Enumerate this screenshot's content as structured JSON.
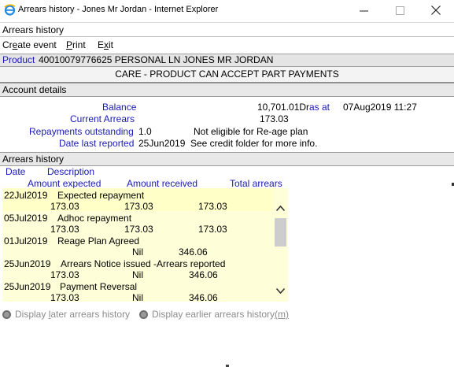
{
  "window": {
    "title": "Arrears history - Jones Mr Jordan - Internet Explorer",
    "minimize_glyph": "–",
    "maximize_glyph": "☐",
    "close_glyph": "✕"
  },
  "app_header": "Arrears history",
  "menu": [
    {
      "label": "Create event",
      "underline_index": 2
    },
    {
      "label": "Print",
      "underline_index": 0
    },
    {
      "label": "Exit",
      "underline_index": 1
    }
  ],
  "product": {
    "label": "Product",
    "value": "40010079776625 PERSONAL LN JONES MR JORDAN",
    "care": "CARE - PRODUCT CAN ACCEPT PART PAYMENTS"
  },
  "account_details": {
    "heading": "Account details",
    "balance_label": "Balance",
    "balance_value": "10,701.01Dr",
    "as_at_label": "as at",
    "as_at_value": "07Aug2019 11:27",
    "current_arrears_label": "Current Arrears",
    "current_arrears_value": "173.03",
    "repayments_outstanding_label": "Repayments outstanding",
    "repayments_outstanding_value": "1.0",
    "reage_note": "Not eligible for Re-age plan",
    "date_last_reported_label": "Date last reported",
    "date_last_reported_value": "25Jun2019",
    "credit_folder_note": "See credit folder for more info."
  },
  "arrears_history": {
    "heading": "Arrears history",
    "columns": {
      "date": "Date",
      "description": "Description",
      "amount_expected": "Amount expected",
      "amount_received": "Amount received",
      "total_arrears": "Total arrears"
    },
    "rows": [
      {
        "date": "22Jul2019",
        "description": "Expected repayment",
        "expected": "173.03",
        "received": "173.03",
        "total": "173.03"
      },
      {
        "date": "05Jul2019",
        "description": "Adhoc repayment",
        "expected": "173.03",
        "received": "173.03",
        "total": "173.03"
      },
      {
        "date": "01Jul2019",
        "description": "Reage Plan Agreed",
        "expected": "",
        "received": "Nil",
        "total": "346.06"
      },
      {
        "date": "25Jun2019",
        "description": "Arrears Notice issued -Arrears reported",
        "expected": "173.03",
        "received": "Nil",
        "total": "346.06"
      },
      {
        "date": "25Jun2019",
        "description": "Payment Reversal",
        "expected": "173.03",
        "received": "Nil",
        "total": "346.06"
      }
    ]
  },
  "navigation": {
    "later_label_pre": "Display ",
    "later_label_u": "l",
    "later_label_post": "ater arrears history",
    "earlier_label": "Display earlier arrears history",
    "earlier_shortcut": "(m)"
  },
  "colors": {
    "label_blue": "#1a1ab4",
    "list_bg": "#fefed8",
    "disabled_text": "#8c8c8c"
  }
}
